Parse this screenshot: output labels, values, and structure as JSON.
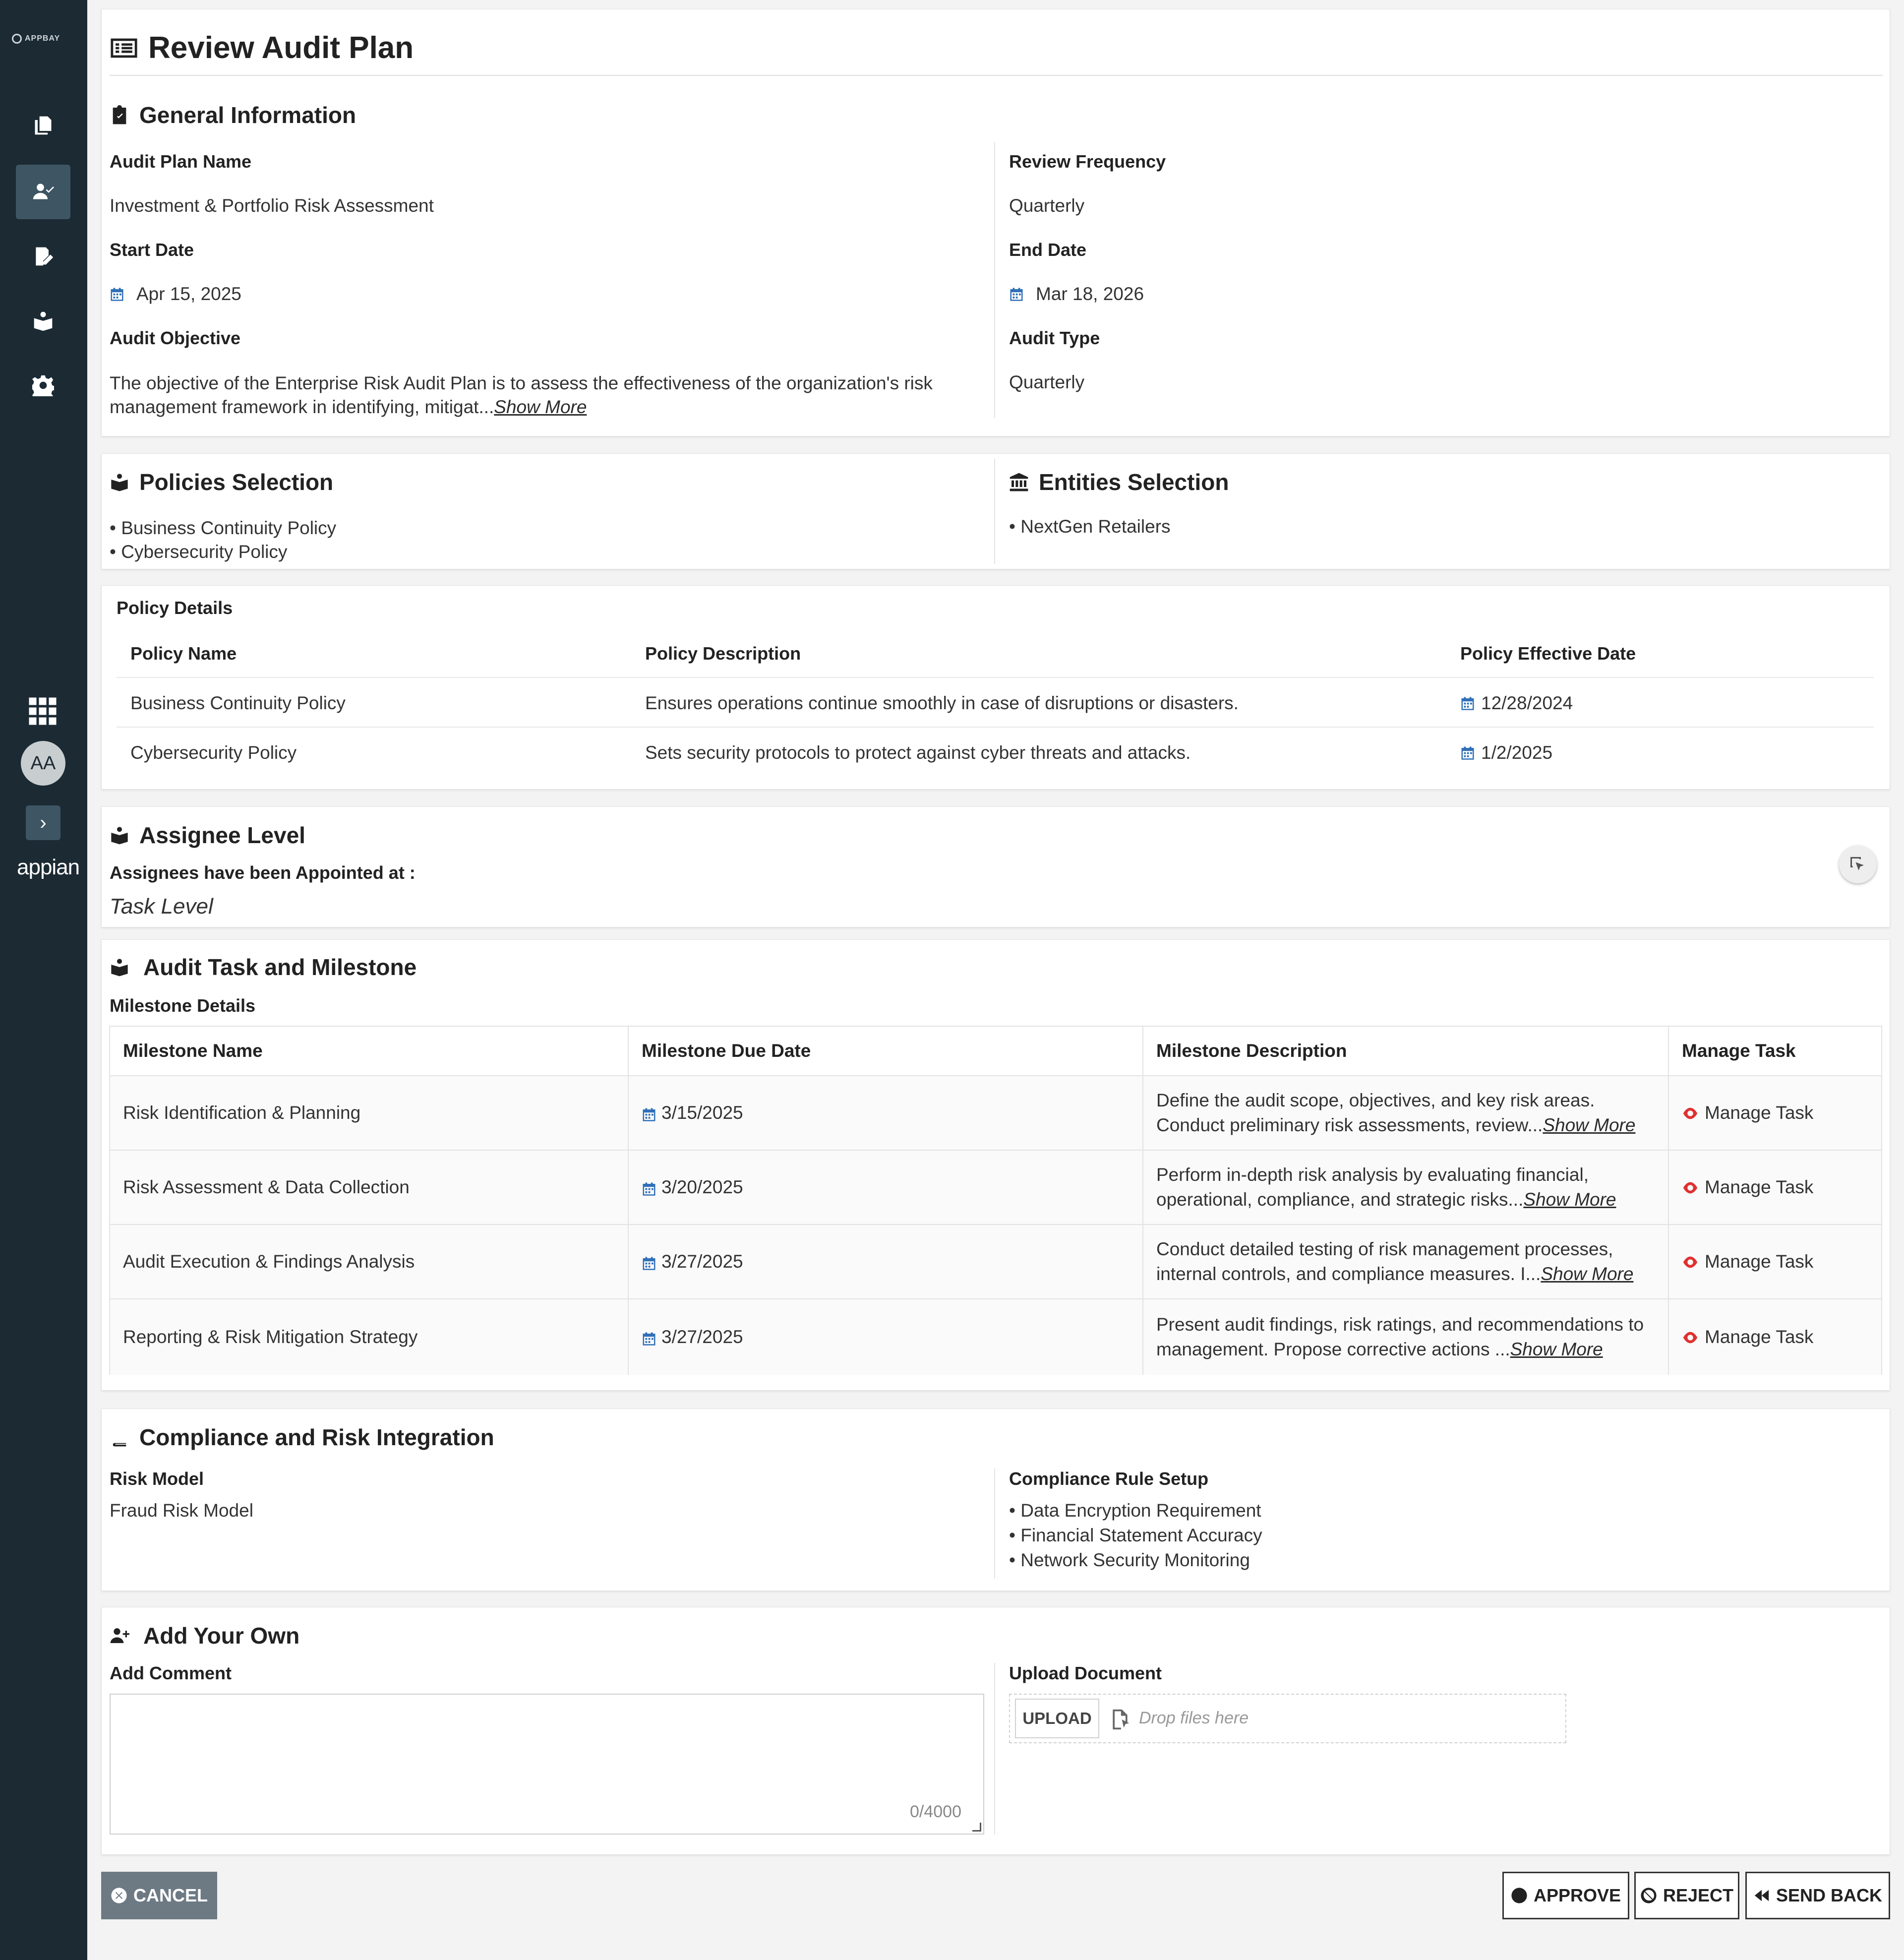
{
  "sidebar": {
    "logo_text": "APPBAY",
    "avatar_initials": "AA",
    "brand": "appian"
  },
  "page_title": "Review Audit Plan",
  "general": {
    "title": "General Information",
    "audit_plan_name_label": "Audit Plan Name",
    "audit_plan_name": "Investment & Portfolio Risk Assessment",
    "review_frequency_label": "Review Frequency",
    "review_frequency": "Quarterly",
    "start_date_label": "Start Date",
    "start_date": "Apr 15, 2025",
    "end_date_label": "End Date",
    "end_date": "Mar 18, 2026",
    "audit_objective_label": "Audit Objective",
    "audit_objective_line1": "The objective of the Enterprise Risk Audit Plan is to assess the effectiveness of the organization's risk",
    "audit_objective_line2": "management framework in identifying, mitigat...",
    "show_more": "Show More",
    "audit_type_label": "Audit Type",
    "audit_type": "Quarterly"
  },
  "policies": {
    "title": "Policies Selection",
    "items": [
      "• Business Continuity Policy",
      "• Cybersecurity Policy"
    ]
  },
  "entities": {
    "title": "Entities Selection",
    "items": [
      "• NextGen Retailers"
    ]
  },
  "policy_details": {
    "title": "Policy Details",
    "headers": [
      "Policy Name",
      "Policy Description",
      "Policy Effective Date"
    ],
    "rows": [
      [
        "Business Continuity Policy",
        "Ensures operations continue smoothly in case of disruptions or disasters.",
        "12/28/2024"
      ],
      [
        "Cybersecurity Policy",
        "Sets security protocols to protect against cyber threats and attacks.",
        "1/2/2025"
      ]
    ]
  },
  "assignee": {
    "title": "Assignee Level",
    "label": "Assignees have been Appointed at :",
    "value": "Task Level"
  },
  "milestones": {
    "title": "Audit Task and Milestone",
    "subtitle": "Milestone Details",
    "headers": [
      "Milestone Name",
      "Milestone Due Date",
      "Milestone Description",
      "Manage Task"
    ],
    "rows": [
      {
        "name": "Risk Identification & Planning",
        "date": "3/15/2025",
        "desc1": "Define the audit scope, objectives, and key risk areas.",
        "desc2": "Conduct preliminary risk assessments, review...",
        "more": "Show More",
        "action": "Manage Task"
      },
      {
        "name": "Risk Assessment & Data Collection",
        "date": "3/20/2025",
        "desc1": "Perform in-depth risk analysis by evaluating financial,",
        "desc2": "operational, compliance, and strategic risks...",
        "more": "Show More",
        "action": "Manage Task"
      },
      {
        "name": "Audit Execution & Findings Analysis",
        "date": "3/27/2025",
        "desc1": "Conduct detailed testing of risk management processes,",
        "desc2": "internal controls, and compliance measures. I...",
        "more": "Show More",
        "action": "Manage Task"
      },
      {
        "name": "Reporting & Risk Mitigation Strategy",
        "date": "3/27/2025",
        "desc1": "Present audit findings, risk ratings, and recommendations to",
        "desc2": "management. Propose corrective actions ...",
        "more": "Show More",
        "action": "Manage Task"
      }
    ]
  },
  "compliance": {
    "title": "Compliance and Risk Integration",
    "risk_model_label": "Risk Model",
    "risk_model": "Fraud Risk Model",
    "rule_setup_label": "Compliance Rule Setup",
    "rules": [
      "• Data Encryption Requirement",
      "• Financial Statement Accuracy",
      "• Network Security Monitoring"
    ]
  },
  "add_own": {
    "title": "Add Your Own",
    "comment_label": "Add Comment",
    "comment_counter": "0/4000",
    "upload_label": "Upload Document",
    "upload_button": "UPLOAD",
    "drop_placeholder": "Drop files here"
  },
  "actions": {
    "cancel": "CANCEL",
    "approve": "APPROVE",
    "reject": "REJECT",
    "send_back": "SEND BACK"
  }
}
